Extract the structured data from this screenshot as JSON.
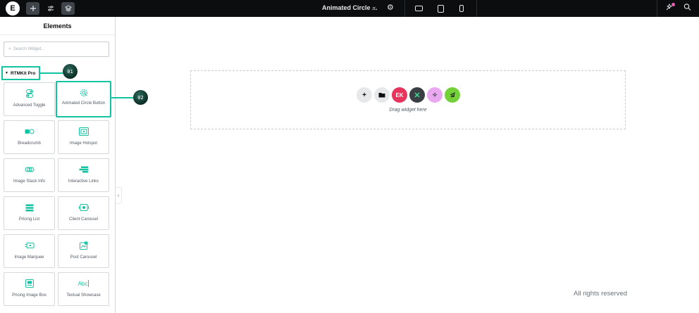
{
  "topbar": {
    "logo": "E",
    "add_icon": "plus-icon",
    "settings_icon": "sliders-icon",
    "structure_icon": "layers-icon",
    "doc_title": "Animated Circle ...",
    "chevron": "⌄",
    "doc_settings_icon": "gear-icon",
    "devices": [
      "desktop",
      "tablet",
      "mobile"
    ],
    "whats_new_icon": "sparkle-icon",
    "search_icon": "search-icon"
  },
  "sidebar": {
    "title": "Elements",
    "search_placeholder": "Search Widget...",
    "category": "RTMKit Pro",
    "callouts": [
      "01",
      "02"
    ],
    "widgets": [
      {
        "label": "Advanced Toggle",
        "icon": "toggle-icon"
      },
      {
        "label": "Animated Circle Button",
        "icon": "circle-button-icon"
      },
      {
        "label": "Breadcrumb",
        "icon": "breadcrumb-icon"
      },
      {
        "label": "Image Hotspot",
        "icon": "image-hotspot-icon"
      },
      {
        "label": "Image Stack Info",
        "icon": "image-stack-icon"
      },
      {
        "label": "Interactive Links",
        "icon": "links-icon"
      },
      {
        "label": "Pricing List",
        "icon": "pricing-list-icon"
      },
      {
        "label": "Client Carousel",
        "icon": "client-carousel-icon"
      },
      {
        "label": "Image Marquee",
        "icon": "image-marquee-icon"
      },
      {
        "label": "Post Carousel",
        "icon": "post-carousel-icon"
      },
      {
        "label": "Pricing Image Box",
        "icon": "pricing-image-box-icon"
      },
      {
        "label": "Textual Showcase",
        "icon": "textual-showcase-icon"
      }
    ],
    "textual_icon_glyph": "Abc"
  },
  "canvas": {
    "drop_text": "Drag widget here",
    "buttons": [
      {
        "name": "add-section-button",
        "bg": "#e6e8ea",
        "glyph": "+"
      },
      {
        "name": "add-template-button",
        "bg": "#e6e8ea",
        "glyph": "▪"
      },
      {
        "name": "elementskit-button",
        "bg": "#e7345d",
        "glyph": "EK"
      },
      {
        "name": "plugin-x-button",
        "bg": "#3b3f44",
        "glyph": "✕"
      },
      {
        "name": "ai-button",
        "bg": "#e9a8f0",
        "glyph": "✧"
      },
      {
        "name": "rtmkit-button",
        "bg": "#75d13a",
        "glyph": "≰"
      }
    ],
    "footer": "All rights reserved"
  },
  "colors": {
    "accent": "#14c3a1",
    "topbar": "#0c0d0e"
  }
}
